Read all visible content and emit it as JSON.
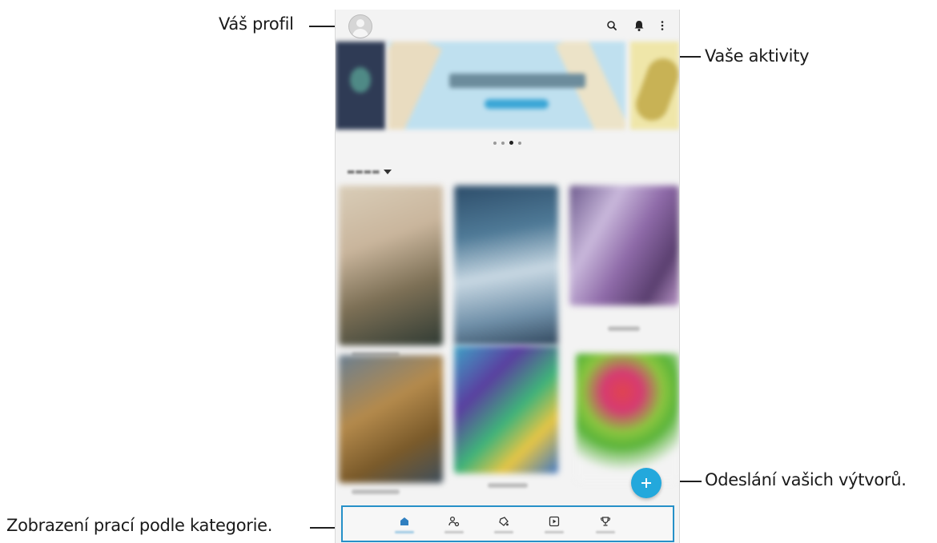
{
  "callouts": {
    "profile": "Váš profil",
    "activities": "Vaše aktivity",
    "upload": "Odeslání vašich výtvorů.",
    "categories": "Zobrazení prací podle kategorie."
  },
  "app": {
    "accent": "#23a8dc",
    "topbar_icons": [
      "profile-avatar",
      "search-icon",
      "bell-icon",
      "more-vertical-icon"
    ],
    "carousel": {
      "pages": 4,
      "active_page": 3
    },
    "nav_items": [
      "home-icon",
      "users-icon",
      "palette-icon",
      "play-icon",
      "trophy-icon"
    ],
    "active_nav": "home-icon",
    "fab_icon": "plus-icon"
  }
}
